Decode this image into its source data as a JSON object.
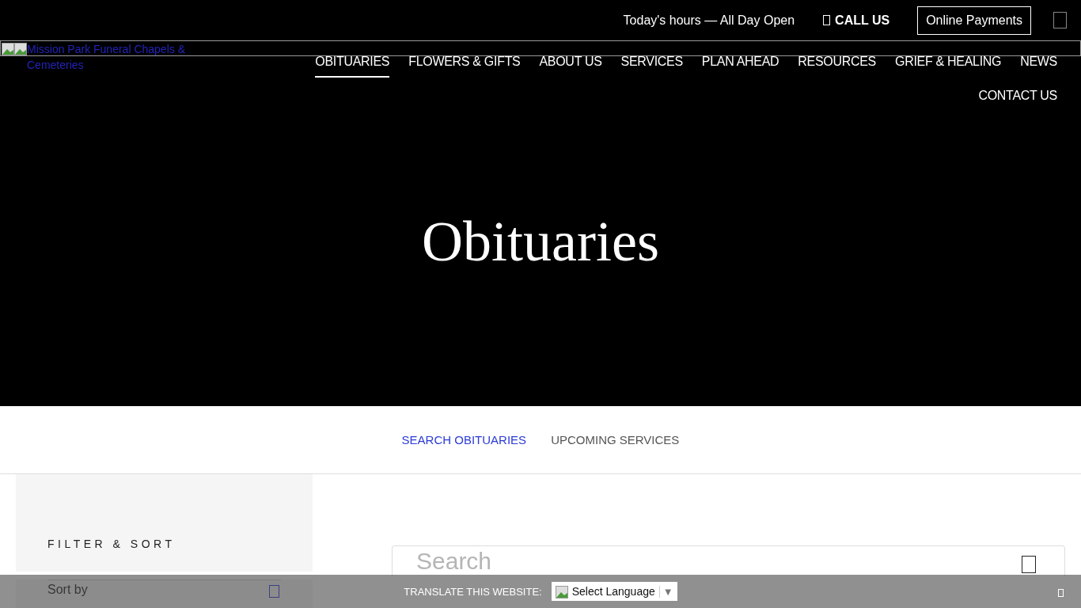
{
  "top_bar": {
    "hours": "Today's hours — All Day Open",
    "call": "CALL US",
    "payments": "Online Payments"
  },
  "logo": {
    "alt": "Mission Park Funeral Chapels & Cemeteries"
  },
  "nav": [
    {
      "label": "OBITUARIES",
      "selected": true
    },
    {
      "label": "FLOWERS & GIFTS",
      "selected": false
    },
    {
      "label": "ABOUT US",
      "selected": false
    },
    {
      "label": "SERVICES",
      "selected": false
    },
    {
      "label": "PLAN AHEAD",
      "selected": false
    },
    {
      "label": "RESOURCES",
      "selected": false
    },
    {
      "label": "GRIEF & HEALING",
      "selected": false
    },
    {
      "label": "NEWS",
      "selected": false
    },
    {
      "label": "CONTACT US",
      "selected": false
    }
  ],
  "hero": {
    "title": "Obituaries"
  },
  "tabs": [
    {
      "label": "SEARCH OBITUARIES",
      "selected": true
    },
    {
      "label": "UPCOMING SERVICES",
      "selected": false
    }
  ],
  "sidebar": {
    "heading": "FILTER & SORT",
    "sort_label": "Sort by"
  },
  "search": {
    "placeholder": "Search"
  },
  "translate_bar": {
    "label": "TRANSLATE THIS WEBSITE:",
    "select": "Select Language",
    "arrow": "▼"
  }
}
